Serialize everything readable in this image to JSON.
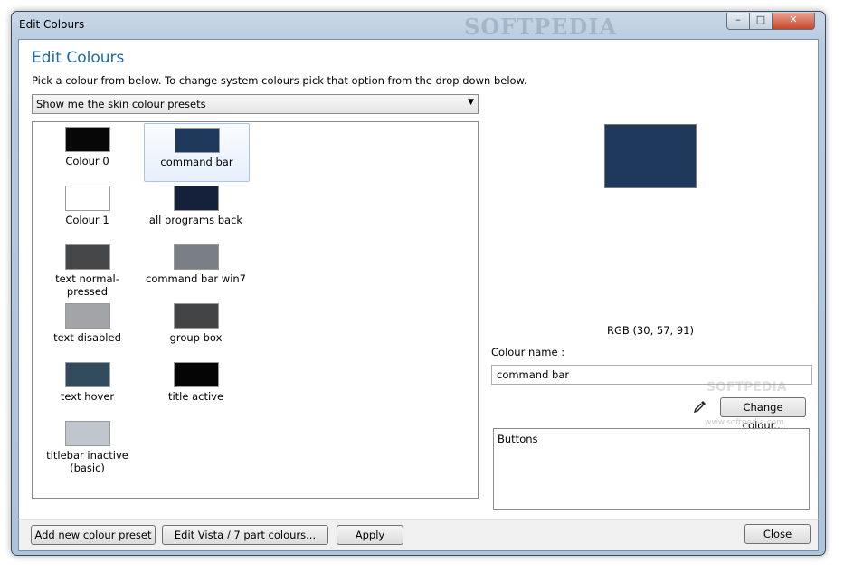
{
  "window": {
    "title": "Edit Colours",
    "watermark": "SOFTPEDIA",
    "controls": {
      "minimize": "–",
      "maximize": "□",
      "close": "✕"
    }
  },
  "header": {
    "title": "Edit Colours",
    "instructions": "Pick a colour from below.  To change system colours pick that option from the drop down below."
  },
  "dropdown": {
    "selected": "Show me the skin colour presets"
  },
  "presets": [
    {
      "label": "Colour 0",
      "color": "#070707"
    },
    {
      "label": "command bar",
      "color": "#1e395b",
      "selected": true
    },
    {
      "label": "Colour 1",
      "color": "#ffffff"
    },
    {
      "label": "all programs back",
      "color": "#15203a"
    },
    {
      "label": "text normal-pressed",
      "color": "#454749"
    },
    {
      "label": "command bar win7",
      "color": "#7a7e86"
    },
    {
      "label": "text disabled",
      "color": "#a2a4a8"
    },
    {
      "label": "group box",
      "color": "#434446"
    },
    {
      "label": "text hover",
      "color": "#324b5c"
    },
    {
      "label": "title active",
      "color": "#050505"
    },
    {
      "label": "titlebar inactive\n(basic)",
      "color": "#bfc6cd"
    }
  ],
  "detail": {
    "preview_color": "#1e395b",
    "rgb_text": "RGB (30, 57, 91)",
    "colour_name_label": "Colour name :",
    "colour_name_value": "command bar",
    "change_button": "Change colour...",
    "usage_text": "Buttons",
    "watermark": "SOFTPEDIA",
    "watermark_url": "www.softpedia.com"
  },
  "footer": {
    "add_preset": "Add new colour preset",
    "edit_vista": "Edit Vista / 7 part colours...",
    "apply": "Apply",
    "close": "Close"
  }
}
